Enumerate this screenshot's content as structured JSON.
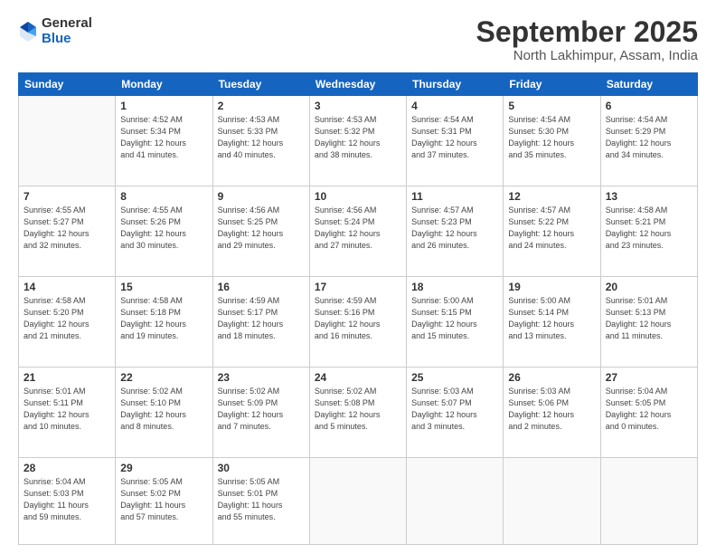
{
  "header": {
    "logo_general": "General",
    "logo_blue": "Blue",
    "month_title": "September 2025",
    "subtitle": "North Lakhimpur, Assam, India"
  },
  "days_of_week": [
    "Sunday",
    "Monday",
    "Tuesday",
    "Wednesday",
    "Thursday",
    "Friday",
    "Saturday"
  ],
  "weeks": [
    [
      {
        "day": "",
        "info": ""
      },
      {
        "day": "1",
        "info": "Sunrise: 4:52 AM\nSunset: 5:34 PM\nDaylight: 12 hours\nand 41 minutes."
      },
      {
        "day": "2",
        "info": "Sunrise: 4:53 AM\nSunset: 5:33 PM\nDaylight: 12 hours\nand 40 minutes."
      },
      {
        "day": "3",
        "info": "Sunrise: 4:53 AM\nSunset: 5:32 PM\nDaylight: 12 hours\nand 38 minutes."
      },
      {
        "day": "4",
        "info": "Sunrise: 4:54 AM\nSunset: 5:31 PM\nDaylight: 12 hours\nand 37 minutes."
      },
      {
        "day": "5",
        "info": "Sunrise: 4:54 AM\nSunset: 5:30 PM\nDaylight: 12 hours\nand 35 minutes."
      },
      {
        "day": "6",
        "info": "Sunrise: 4:54 AM\nSunset: 5:29 PM\nDaylight: 12 hours\nand 34 minutes."
      }
    ],
    [
      {
        "day": "7",
        "info": "Sunrise: 4:55 AM\nSunset: 5:27 PM\nDaylight: 12 hours\nand 32 minutes."
      },
      {
        "day": "8",
        "info": "Sunrise: 4:55 AM\nSunset: 5:26 PM\nDaylight: 12 hours\nand 30 minutes."
      },
      {
        "day": "9",
        "info": "Sunrise: 4:56 AM\nSunset: 5:25 PM\nDaylight: 12 hours\nand 29 minutes."
      },
      {
        "day": "10",
        "info": "Sunrise: 4:56 AM\nSunset: 5:24 PM\nDaylight: 12 hours\nand 27 minutes."
      },
      {
        "day": "11",
        "info": "Sunrise: 4:57 AM\nSunset: 5:23 PM\nDaylight: 12 hours\nand 26 minutes."
      },
      {
        "day": "12",
        "info": "Sunrise: 4:57 AM\nSunset: 5:22 PM\nDaylight: 12 hours\nand 24 minutes."
      },
      {
        "day": "13",
        "info": "Sunrise: 4:58 AM\nSunset: 5:21 PM\nDaylight: 12 hours\nand 23 minutes."
      }
    ],
    [
      {
        "day": "14",
        "info": "Sunrise: 4:58 AM\nSunset: 5:20 PM\nDaylight: 12 hours\nand 21 minutes."
      },
      {
        "day": "15",
        "info": "Sunrise: 4:58 AM\nSunset: 5:18 PM\nDaylight: 12 hours\nand 19 minutes."
      },
      {
        "day": "16",
        "info": "Sunrise: 4:59 AM\nSunset: 5:17 PM\nDaylight: 12 hours\nand 18 minutes."
      },
      {
        "day": "17",
        "info": "Sunrise: 4:59 AM\nSunset: 5:16 PM\nDaylight: 12 hours\nand 16 minutes."
      },
      {
        "day": "18",
        "info": "Sunrise: 5:00 AM\nSunset: 5:15 PM\nDaylight: 12 hours\nand 15 minutes."
      },
      {
        "day": "19",
        "info": "Sunrise: 5:00 AM\nSunset: 5:14 PM\nDaylight: 12 hours\nand 13 minutes."
      },
      {
        "day": "20",
        "info": "Sunrise: 5:01 AM\nSunset: 5:13 PM\nDaylight: 12 hours\nand 11 minutes."
      }
    ],
    [
      {
        "day": "21",
        "info": "Sunrise: 5:01 AM\nSunset: 5:11 PM\nDaylight: 12 hours\nand 10 minutes."
      },
      {
        "day": "22",
        "info": "Sunrise: 5:02 AM\nSunset: 5:10 PM\nDaylight: 12 hours\nand 8 minutes."
      },
      {
        "day": "23",
        "info": "Sunrise: 5:02 AM\nSunset: 5:09 PM\nDaylight: 12 hours\nand 7 minutes."
      },
      {
        "day": "24",
        "info": "Sunrise: 5:02 AM\nSunset: 5:08 PM\nDaylight: 12 hours\nand 5 minutes."
      },
      {
        "day": "25",
        "info": "Sunrise: 5:03 AM\nSunset: 5:07 PM\nDaylight: 12 hours\nand 3 minutes."
      },
      {
        "day": "26",
        "info": "Sunrise: 5:03 AM\nSunset: 5:06 PM\nDaylight: 12 hours\nand 2 minutes."
      },
      {
        "day": "27",
        "info": "Sunrise: 5:04 AM\nSunset: 5:05 PM\nDaylight: 12 hours\nand 0 minutes."
      }
    ],
    [
      {
        "day": "28",
        "info": "Sunrise: 5:04 AM\nSunset: 5:03 PM\nDaylight: 11 hours\nand 59 minutes."
      },
      {
        "day": "29",
        "info": "Sunrise: 5:05 AM\nSunset: 5:02 PM\nDaylight: 11 hours\nand 57 minutes."
      },
      {
        "day": "30",
        "info": "Sunrise: 5:05 AM\nSunset: 5:01 PM\nDaylight: 11 hours\nand 55 minutes."
      },
      {
        "day": "",
        "info": ""
      },
      {
        "day": "",
        "info": ""
      },
      {
        "day": "",
        "info": ""
      },
      {
        "day": "",
        "info": ""
      }
    ]
  ]
}
